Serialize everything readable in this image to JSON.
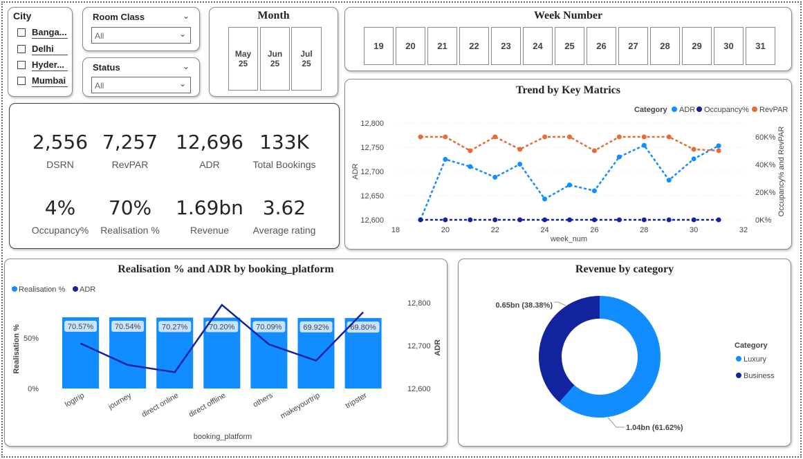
{
  "colors": {
    "adr": "#118DFF",
    "occupancy": "#12239E",
    "revpar": "#E66C37",
    "luxury": "#118DFF",
    "business": "#12239E"
  },
  "city_slicer": {
    "title": "City",
    "items": [
      "Banga...",
      "Delhi",
      "Hyder...",
      "Mumbai"
    ]
  },
  "room_class_slicer": {
    "title": "Room Class",
    "value": "All"
  },
  "status_slicer": {
    "title": "Status",
    "value": "All"
  },
  "month_slicer": {
    "title": "Month",
    "items": [
      {
        "month": "May",
        "year": "25"
      },
      {
        "month": "Jun",
        "year": "25"
      },
      {
        "month": "Jul",
        "year": "25"
      }
    ]
  },
  "week_slicer": {
    "title": "Week Number",
    "items": [
      "19",
      "20",
      "21",
      "22",
      "23",
      "24",
      "25",
      "26",
      "27",
      "28",
      "29",
      "30",
      "31"
    ]
  },
  "kpis": [
    {
      "value": "2,556",
      "label": "DSRN"
    },
    {
      "value": "7,257",
      "label": "RevPAR"
    },
    {
      "value": "12,696",
      "label": "ADR"
    },
    {
      "value": "133K",
      "label": "Total Bookings"
    },
    {
      "value": "4%",
      "label": "Occupancy%"
    },
    {
      "value": "70%",
      "label": "Realisation %"
    },
    {
      "value": "1.69bn",
      "label": "Revenue"
    },
    {
      "value": "3.62",
      "label": "Average rating"
    }
  ],
  "chart_data": [
    {
      "type": "line",
      "title": "Trend by Key Matrics",
      "xlabel": "week_num",
      "ylabel": "ADR",
      "y2label": "Occupancy% and RevPAR",
      "legend_title": "Category",
      "legend_position": "top-right",
      "xlim": [
        18,
        32
      ],
      "x_ticks": [
        "18",
        "20",
        "22",
        "24",
        "26",
        "28",
        "30",
        "32"
      ],
      "ylim": [
        12600,
        12800
      ],
      "y_ticks": [
        "12,600",
        "12,650",
        "12,700",
        "12,750",
        "12,800"
      ],
      "y2lim": [
        0,
        70
      ],
      "y2_ticks": [
        "0K%",
        "20K%",
        "40K%",
        "60K%"
      ],
      "x": [
        19,
        20,
        21,
        22,
        23,
        24,
        25,
        26,
        27,
        28,
        29,
        30,
        31
      ],
      "series": [
        {
          "name": "ADR",
          "axis": "left",
          "values": [
            12600,
            12725,
            12710,
            12688,
            12715,
            12643,
            12672,
            12660,
            12730,
            12754,
            12682,
            12726,
            12753
          ]
        },
        {
          "name": "Occupancy%",
          "axis": "right",
          "values": [
            0,
            0,
            0,
            0,
            0,
            0,
            0,
            0,
            0,
            0,
            0,
            0,
            0
          ]
        },
        {
          "name": "RevPAR",
          "axis": "right",
          "values": [
            60,
            60,
            50,
            60,
            51,
            60,
            60,
            50,
            60,
            60,
            60,
            51,
            50
          ]
        }
      ]
    },
    {
      "type": "bar",
      "title": "Realisation % and ADR by booking_platform",
      "xlabel": "booking_platform",
      "ylabel": "Realisation %",
      "y2label": "ADR",
      "legend_position": "top-left",
      "categories": [
        "logtrip",
        "journey",
        "direct online",
        "direct offline",
        "others",
        "makeyourtrip",
        "tripster"
      ],
      "y_ticks": [
        "0%",
        "50%"
      ],
      "y2_ticks": [
        "12,600",
        "12,700",
        "12,800"
      ],
      "ylim": [
        0,
        100
      ],
      "y2lim": [
        12600,
        12800
      ],
      "series": [
        {
          "name": "Realisation %",
          "type": "bar",
          "values": [
            70.57,
            70.54,
            70.27,
            70.2,
            70.09,
            69.92,
            69.8
          ],
          "labels": [
            "70.57%",
            "70.54%",
            "70.27%",
            "70.20%",
            "70.09%",
            "69.92%",
            "69.80%"
          ]
        },
        {
          "name": "ADR",
          "type": "line",
          "values": [
            12705,
            12655,
            12638,
            12795,
            12703,
            12665,
            12778
          ]
        }
      ]
    },
    {
      "type": "pie",
      "title": "Revenue by category",
      "legend_title": "Category",
      "legend_position": "right",
      "slices": [
        {
          "name": "Luxury",
          "value": 1.04,
          "label": "1.04bn (61.62%)"
        },
        {
          "name": "Business",
          "value": 0.65,
          "label": "0.65bn (38.38%)"
        }
      ]
    }
  ]
}
